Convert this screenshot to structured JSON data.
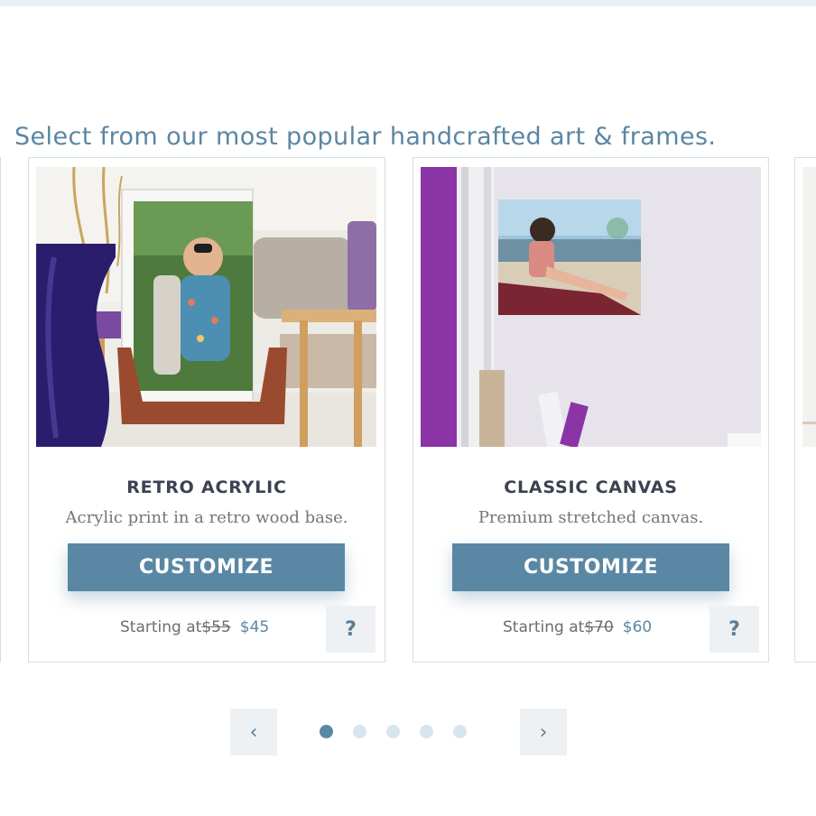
{
  "headline": "Select from our most popular handcrafted art & frames.",
  "products": [
    {
      "title": "RETRO ACRYLIC",
      "description": "Acrylic print in a retro wood base.",
      "button_label": "CUSTOMIZE",
      "starting_label": "Starting at",
      "old_price": "$55",
      "new_price": "$45",
      "help_label": "?"
    },
    {
      "title": "CLASSIC CANVAS",
      "description": "Premium stretched canvas.",
      "button_label": "CUSTOMIZE",
      "starting_label": "Starting at",
      "old_price": "$70",
      "new_price": "$60",
      "help_label": "?"
    }
  ],
  "carousel": {
    "prev_icon": "chevron-left-icon",
    "next_icon": "chevron-right-icon",
    "prev_glyph": "‹",
    "next_glyph": "›",
    "page_count": 5,
    "active_index": 1
  },
  "colors": {
    "accent": "#5a87a3",
    "headline": "#5b86a3",
    "title": "#3c4250",
    "card_border": "#cfe0ea"
  }
}
